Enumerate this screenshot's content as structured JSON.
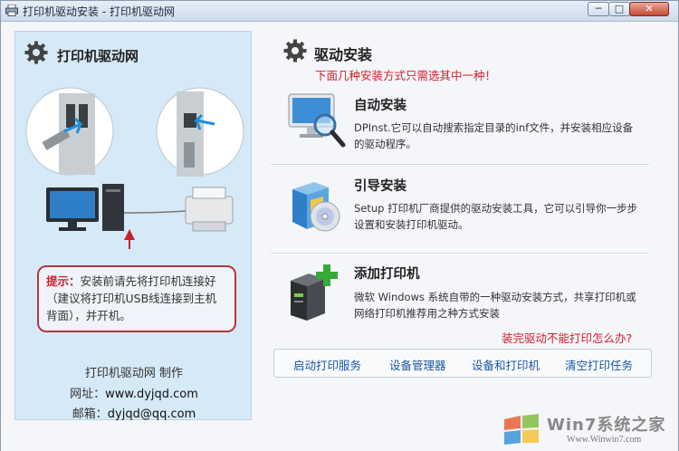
{
  "window": {
    "title": "打印机驱动安装 - 打印机驱动网",
    "min_label": "─",
    "max_label": "□",
    "close_label": "✕"
  },
  "left_panel": {
    "title": "打印机驱动网",
    "tip_label": "提示：",
    "tip_text": "安装前请先将打印机连接好（建议将打印机USB线连接到主机背面），并开机。",
    "credit_line": "打印机驱动网  制作",
    "website_label": "网址：",
    "website_value": "www.dyjqd.com",
    "email_label": "邮箱：",
    "email_value": "dyjqd@qq.com"
  },
  "right_panel": {
    "title": "驱动安装",
    "note": "下面几种安装方式只需选其中一种！",
    "options": [
      {
        "title": "自动安装",
        "desc": "DPInst.它可以自动搜索指定目录的inf文件，并安装相应设备的驱动程序。",
        "icon": "monitor-search-icon"
      },
      {
        "title": "引导安装",
        "desc": "Setup 打印机厂商提供的驱动安装工具，它可以引导你一步步设置和安装打印机驱动。",
        "icon": "software-box-icon"
      },
      {
        "title": "添加打印机",
        "desc": "微软 Windows 系统自带的一种驱动安装方式，共享打印机或网络打印机推荐用之种方式安装",
        "icon": "add-device-icon"
      }
    ],
    "help_link": "装完驱动不能打印怎么办?",
    "links": [
      "启动打印服务",
      "设备管理器",
      "设备和打印机",
      "清空打印任务"
    ]
  },
  "watermark": {
    "brand": "Win7系统之家",
    "url": "Www.Winwin7.com"
  },
  "colors": {
    "accent_red": "#d0202a",
    "link_blue": "#1a56a6",
    "panel_blue": "#d6e9f6"
  }
}
